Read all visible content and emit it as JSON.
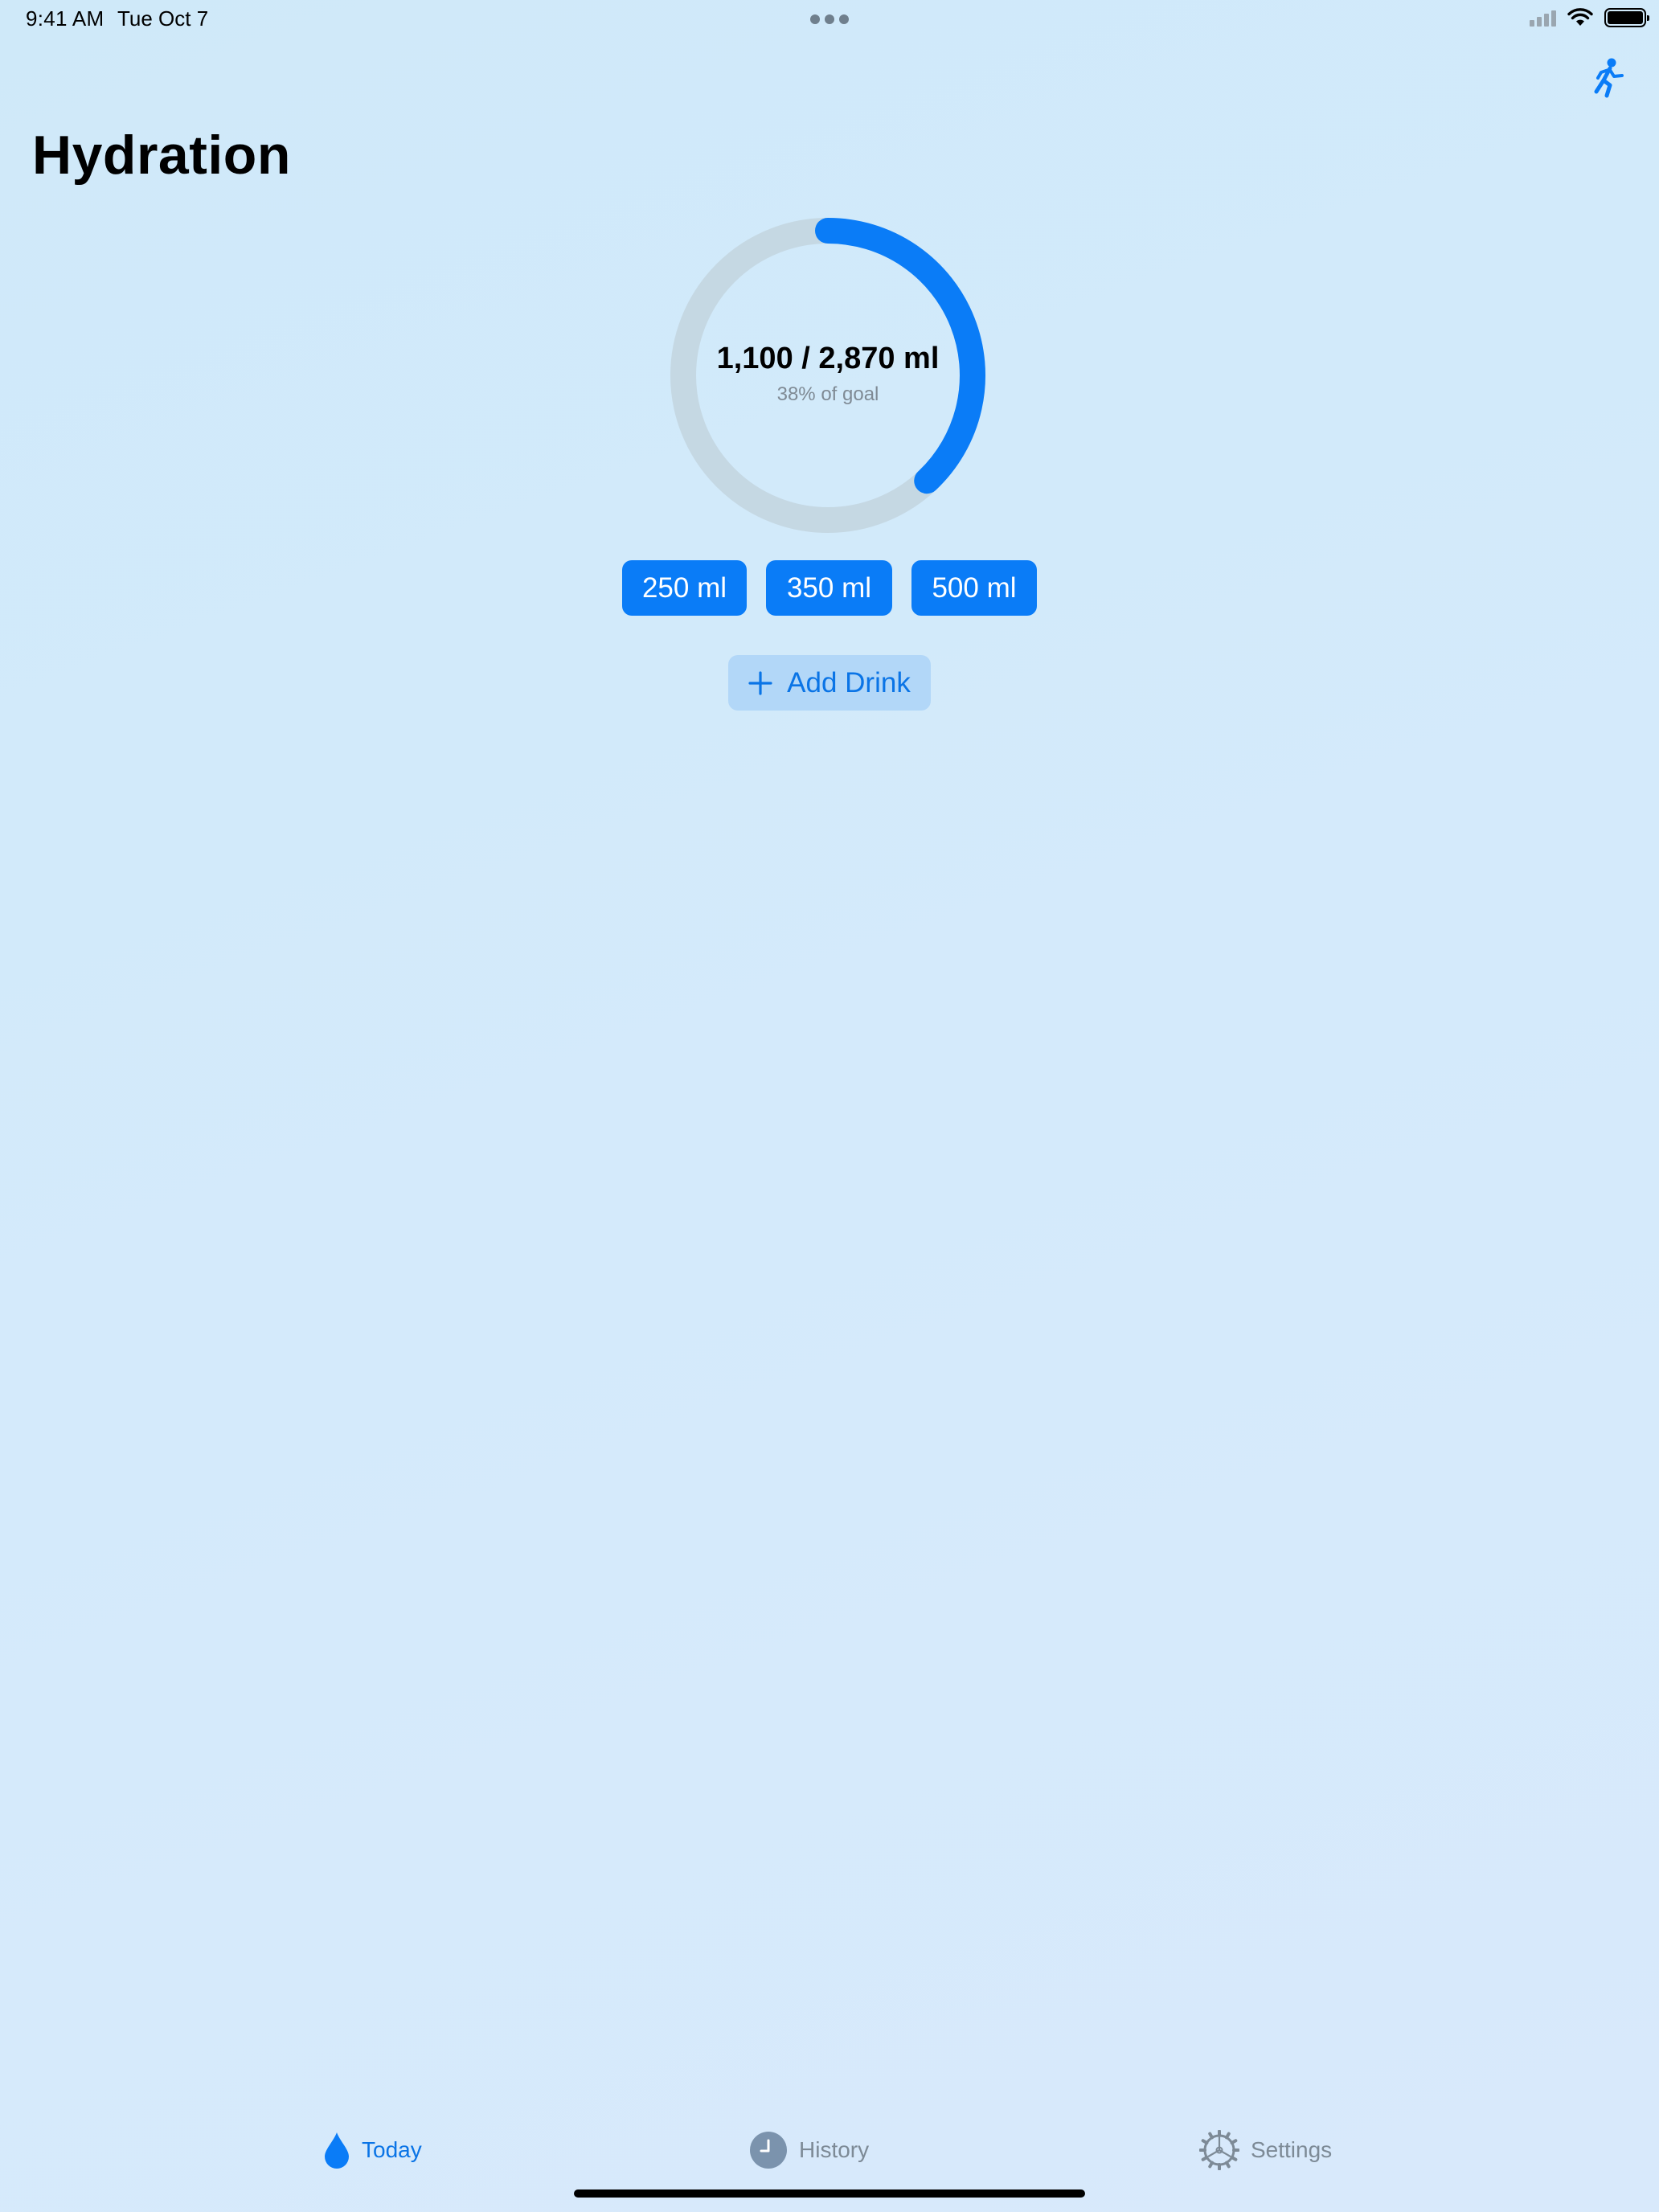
{
  "status_bar": {
    "time": "9:41 AM",
    "date": "Tue Oct 7",
    "icons": [
      "cellular-signal-icon",
      "wifi-icon",
      "battery-icon"
    ]
  },
  "header": {
    "title": "Hydration",
    "activity_icon": "running-figure-icon"
  },
  "progress": {
    "amount_text": "1,100 / 2,870 ml",
    "percent_text": "38% of goal",
    "fraction": 0.38,
    "ring_color": "#0a7cf7",
    "track_color": "#c5d8e3"
  },
  "quick_add": [
    {
      "label": "250 ml"
    },
    {
      "label": "350 ml"
    },
    {
      "label": "500 ml"
    }
  ],
  "add_drink": {
    "label": "Add Drink",
    "icon": "plus-icon"
  },
  "tabs": [
    {
      "label": "Today",
      "icon": "water-drop-icon",
      "selected": true
    },
    {
      "label": "History",
      "icon": "clock-icon",
      "selected": false
    },
    {
      "label": "Settings",
      "icon": "gear-icon",
      "selected": false
    }
  ],
  "colors": {
    "accent": "#0a7cf7",
    "background": "#d3eafa",
    "secondary_button": "#b2d7f8",
    "inactive_tab": "#7d8a96"
  }
}
